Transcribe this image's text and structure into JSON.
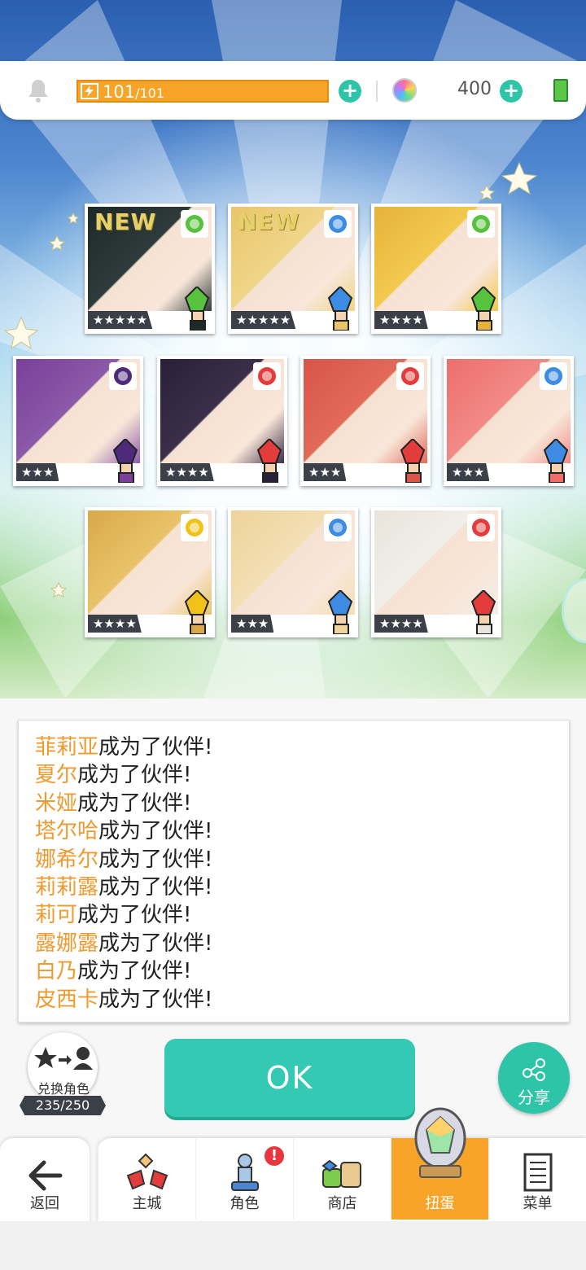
{
  "status": {
    "stamina_current": "101",
    "stamina_max": "/101",
    "gem_count": "400"
  },
  "cards": [
    {
      "id": "c1",
      "stars": "★★★★★",
      "new": "NEW",
      "element": "wind",
      "portrait": "#2f3a3a",
      "hair": "#1d2a28",
      "elementColor": "#57c23d"
    },
    {
      "id": "c2",
      "stars": "★★★★★",
      "new": "NEW",
      "element": "water",
      "portrait": "#f0d68a",
      "hair": "#e9c56a",
      "elementColor": "#3d8be3"
    },
    {
      "id": "c3",
      "stars": "★★★★",
      "new": "",
      "element": "wind",
      "portrait": "#f2c94d",
      "hair": "#e6b23a",
      "elementColor": "#57c23d"
    },
    {
      "id": "c4",
      "stars": "★★★",
      "new": "",
      "element": "dark",
      "portrait": "#8b5aa8",
      "hair": "#7a3f9a",
      "elementColor": "#4d2a7a"
    },
    {
      "id": "c5",
      "stars": "★★★★",
      "new": "",
      "element": "fire",
      "portrait": "#3b2e4a",
      "hair": "#2a1f38",
      "elementColor": "#e23c3c"
    },
    {
      "id": "c6",
      "stars": "★★★",
      "new": "",
      "element": "fire",
      "portrait": "#e06a5a",
      "hair": "#d85548",
      "elementColor": "#e23c3c"
    },
    {
      "id": "c7",
      "stars": "★★★",
      "new": "",
      "element": "water",
      "portrait": "#f08a86",
      "hair": "#ee6e6c",
      "elementColor": "#3d8be3"
    },
    {
      "id": "c8",
      "stars": "★★★★",
      "new": "",
      "element": "thunder",
      "portrait": "#e9c36a",
      "hair": "#d9a84a",
      "elementColor": "#f2c21b"
    },
    {
      "id": "c9",
      "stars": "★★★",
      "new": "",
      "element": "water",
      "portrait": "#f3dfb5",
      "hair": "#eed39a",
      "elementColor": "#3d8be3"
    },
    {
      "id": "c10",
      "stars": "★★★★",
      "new": "",
      "element": "fire",
      "portrait": "#f1efe9",
      "hair": "#e8e4dc",
      "elementColor": "#e23c3c"
    }
  ],
  "messages": [
    {
      "name": "菲莉亚",
      "text": "成为了伙伴!"
    },
    {
      "name": "夏尔",
      "text": "成为了伙伴!"
    },
    {
      "name": "米娅",
      "text": "成为了伙伴!"
    },
    {
      "name": "塔尔哈",
      "text": "成为了伙伴!"
    },
    {
      "name": "娜希尔",
      "text": "成为了伙伴!"
    },
    {
      "name": "莉莉露",
      "text": "成为了伙伴!"
    },
    {
      "name": "莉可",
      "text": "成为了伙伴!"
    },
    {
      "name": "露娜露",
      "text": "成为了伙伴!"
    },
    {
      "name": "白乃",
      "text": "成为了伙伴!"
    },
    {
      "name": "皮西卡",
      "text": "成为了伙伴!"
    }
  ],
  "swap": {
    "label": "兑换角色",
    "count": "235/250"
  },
  "ok_label": "OK",
  "share_label": "分享",
  "nav": {
    "back": "返回",
    "tabs": [
      {
        "label": "主城",
        "icon": "castle-icon"
      },
      {
        "label": "角色",
        "icon": "character-icon",
        "badge": "!"
      },
      {
        "label": "商店",
        "icon": "shop-icon"
      },
      {
        "label": "扭蛋",
        "icon": "gacha-icon",
        "active": true
      },
      {
        "label": "菜单",
        "icon": "menu-icon"
      }
    ]
  }
}
